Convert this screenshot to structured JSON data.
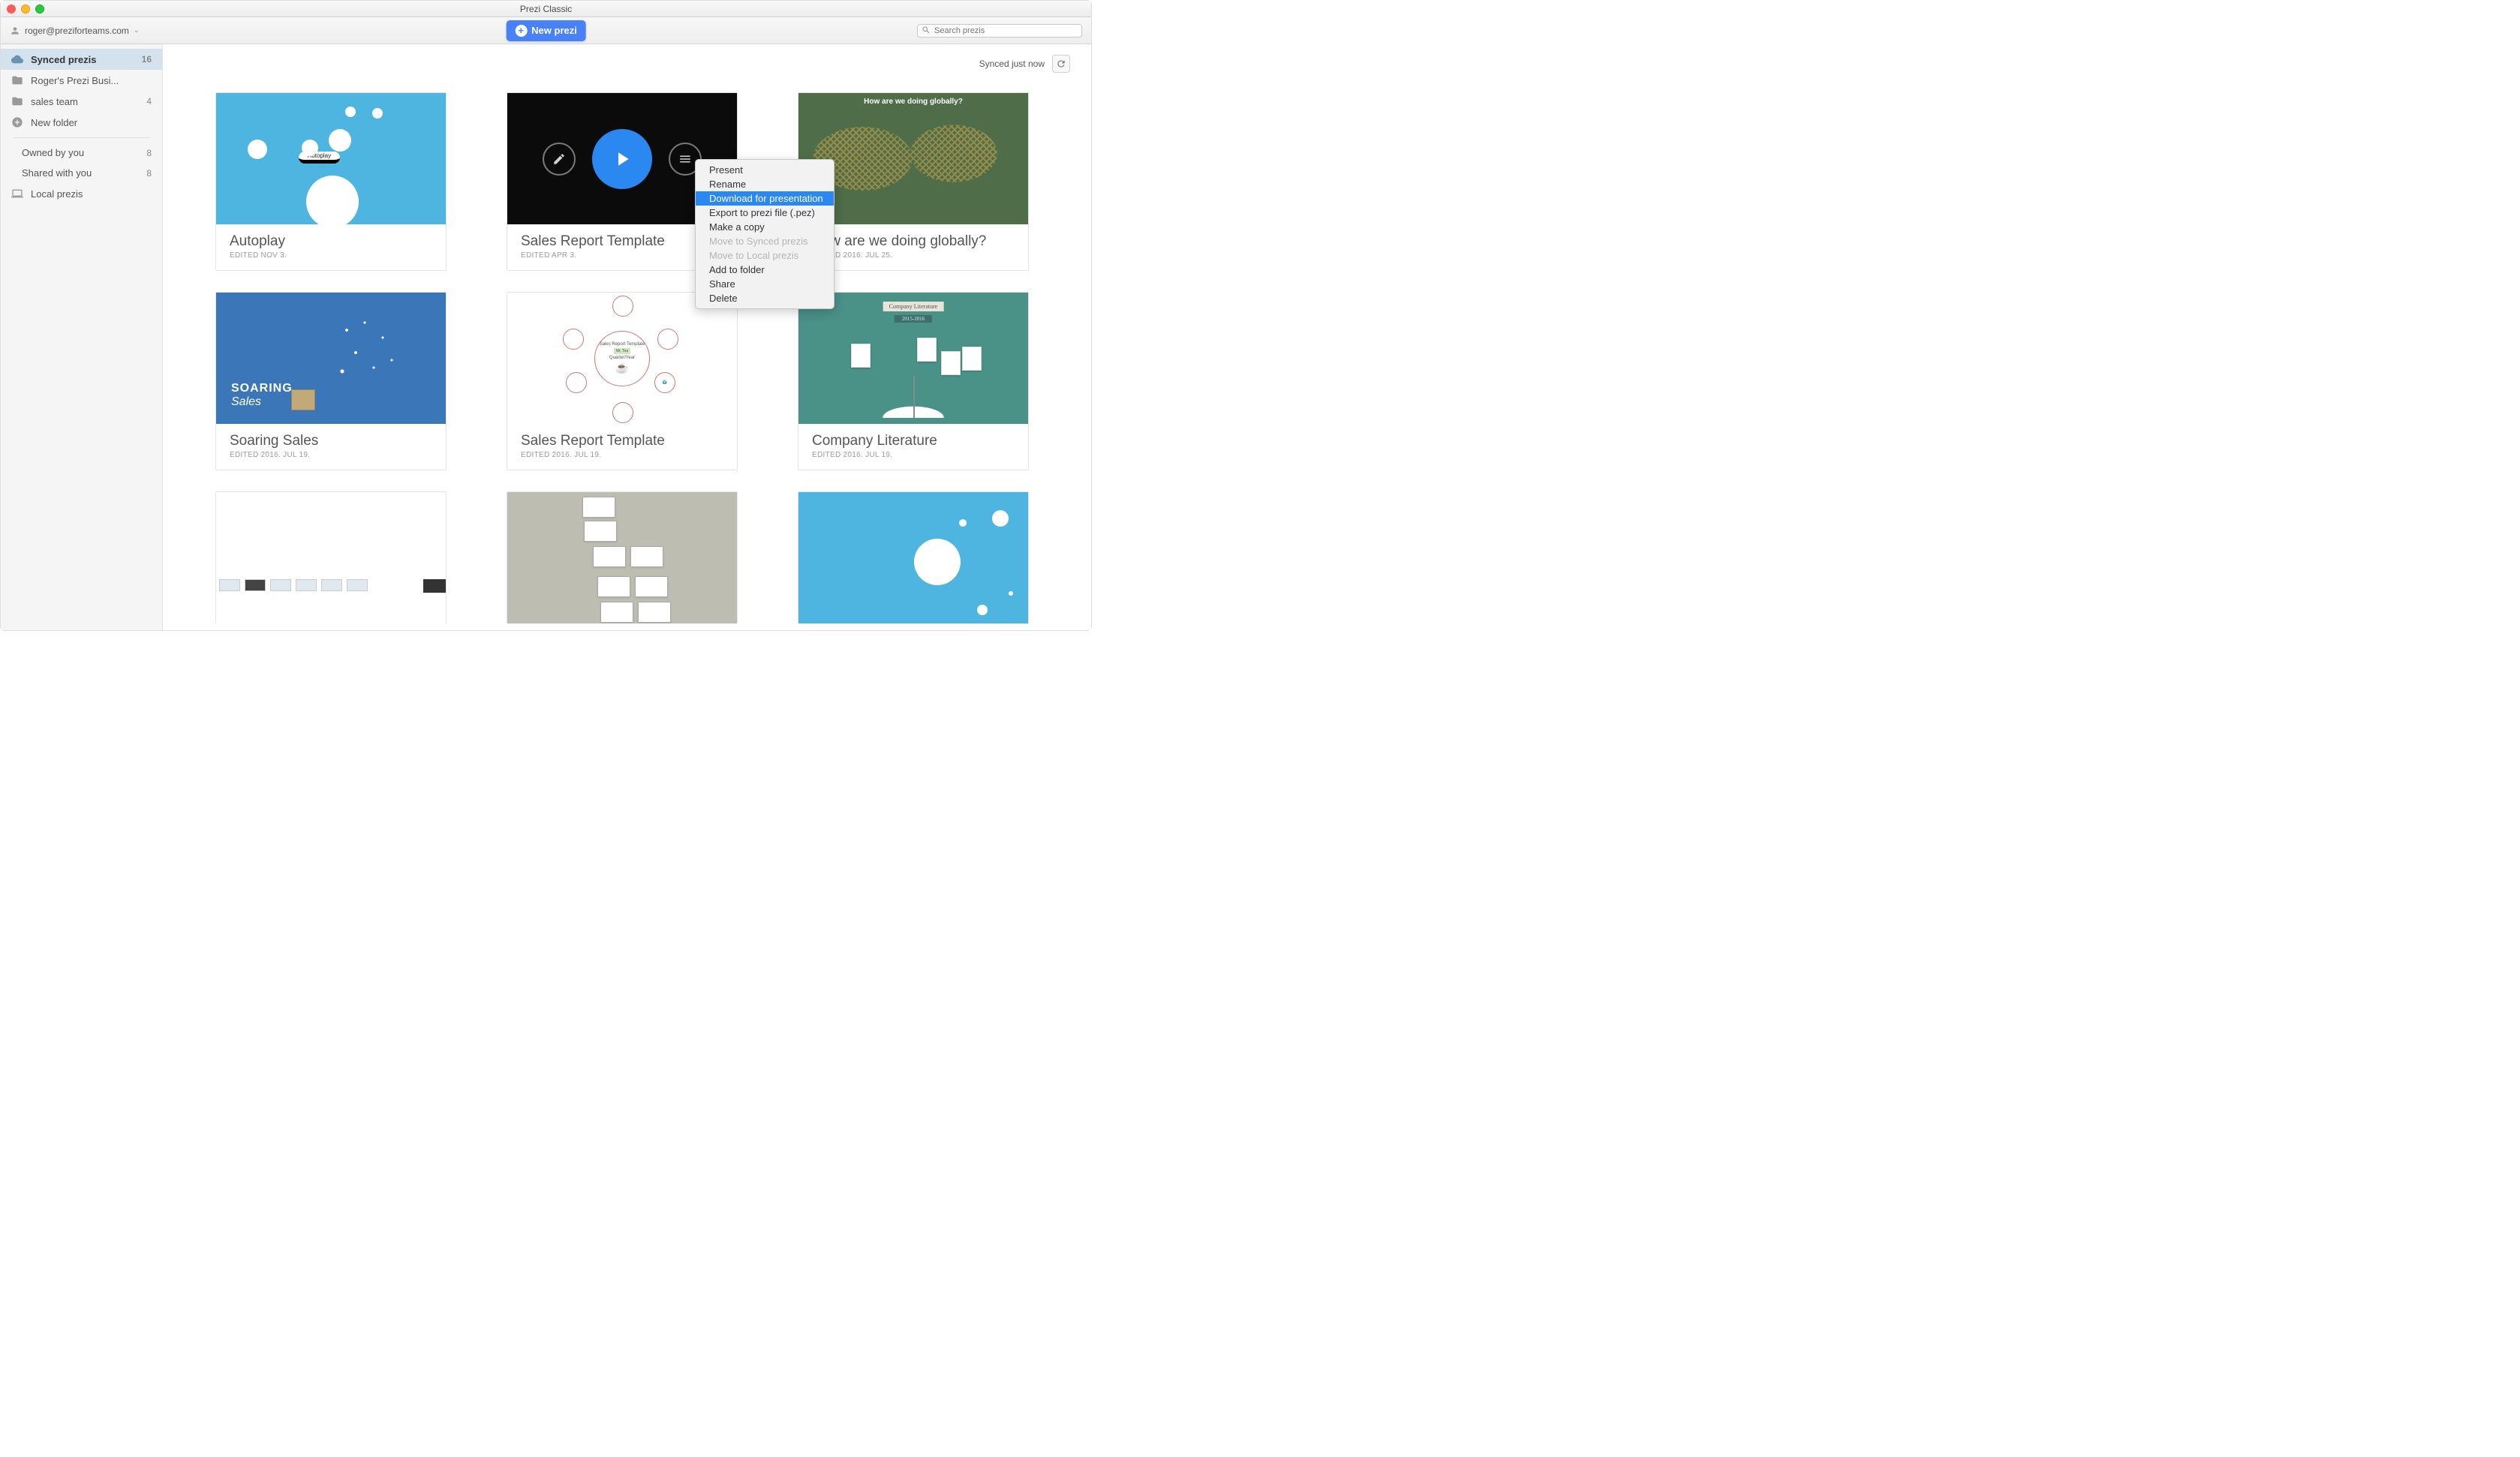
{
  "window": {
    "title": "Prezi Classic"
  },
  "toolbar": {
    "user_email": "roger@preziforteams.com",
    "new_prezi_label": "New prezi",
    "search_placeholder": "Search prezis"
  },
  "sidebar": {
    "items": [
      {
        "label": "Synced prezis",
        "count": "16",
        "icon": "cloud",
        "active": true
      },
      {
        "label": "Roger's Prezi Busi...",
        "count": "",
        "icon": "folder"
      },
      {
        "label": "sales team",
        "count": "4",
        "icon": "folder"
      },
      {
        "label": "New folder",
        "count": "",
        "icon": "plus"
      }
    ],
    "filters": [
      {
        "label": "Owned by you",
        "count": "8"
      },
      {
        "label": "Shared with you",
        "count": "8"
      }
    ],
    "local": {
      "label": "Local prezis",
      "icon": "laptop"
    }
  },
  "sync_status": {
    "text": "Synced just now"
  },
  "context_menu": {
    "items": [
      {
        "label": "Present",
        "state": "normal"
      },
      {
        "label": "Rename",
        "state": "normal"
      },
      {
        "label": "Download for presentation",
        "state": "highlighted"
      },
      {
        "label": "Export to prezi file (.pez)",
        "state": "normal"
      },
      {
        "label": "Make a copy",
        "state": "normal"
      },
      {
        "label": "Move to Synced prezis",
        "state": "disabled"
      },
      {
        "label": "Move to Local prezis",
        "state": "disabled"
      },
      {
        "label": "Add to folder",
        "state": "normal"
      },
      {
        "label": "Share",
        "state": "normal"
      },
      {
        "label": "Delete",
        "state": "normal"
      }
    ]
  },
  "cards": [
    {
      "title": "Autoplay",
      "edited": "EDITED NOV 3.",
      "thumb": "autoplay",
      "thumb_label": "Autoplay"
    },
    {
      "title": "Sales Report Template",
      "edited": "EDITED APR 3.",
      "thumb": "sales",
      "overlay": true,
      "ctx": true
    },
    {
      "title": "How are we doing globally?",
      "edited": "EDITED 2016. JUL 25.",
      "thumb": "global",
      "thumb_banner": "How are we doing globally?"
    },
    {
      "title": "Soaring Sales",
      "edited": "EDITED 2016. JUL 19.",
      "thumb": "soaring",
      "thumb_text_top": "SOARING",
      "thumb_text_bot": "Sales"
    },
    {
      "title": "Sales Report Template",
      "edited": "EDITED 2016. JUL 19.",
      "thumb": "srt2",
      "center_title": "Sales Report Template",
      "center_sub": "Quarter/Year",
      "center_name": "Mr. Tea"
    },
    {
      "title": "Company Literature",
      "edited": "EDITED 2016. JUL 19.",
      "thumb": "complit",
      "ban1": "Company Literature",
      "ban2": "2015-2016"
    },
    {
      "title": "",
      "edited": "",
      "thumb": "white"
    },
    {
      "title": "",
      "edited": "",
      "thumb": "gray"
    },
    {
      "title": "",
      "edited": "",
      "thumb": "blue2"
    }
  ]
}
